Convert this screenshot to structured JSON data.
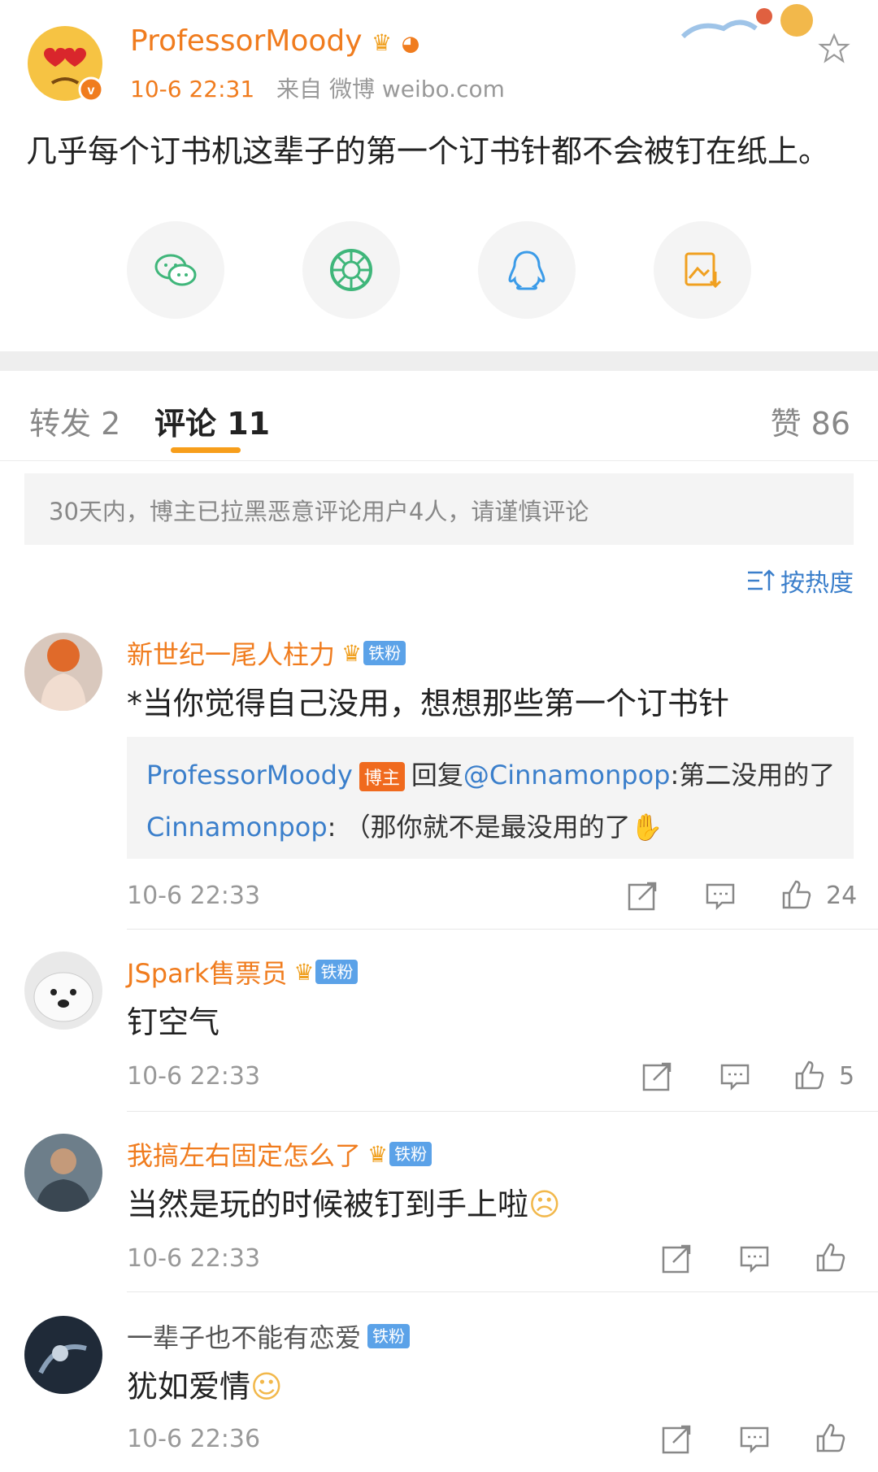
{
  "post": {
    "author": "ProfessorMoody",
    "time": "10-6 22:31",
    "source": "来自 微博 weibo.com",
    "text": "几乎每个订书机这辈子的第一个订书针都不会被钉在纸上。"
  },
  "share_icons": [
    "wechat-icon",
    "moments-icon",
    "qq-icon",
    "save-image-icon"
  ],
  "tabs": {
    "repost": "转发 2",
    "comments": "评论 11",
    "likes": "赞 86"
  },
  "notice": "30天内，博主已拉黑恶意评论用户4人，请谨慎评论",
  "sort_label": "按热度",
  "badges": {
    "fan": "铁粉",
    "host": "博主"
  },
  "comments": [
    {
      "name": "新世纪一尾人柱力",
      "text": "*当你觉得自己没用，想想那些第一个订书针",
      "replies": [
        {
          "user": "ProfessorMoody",
          "prefix": "回复",
          "mention": "@Cinnamonpop",
          "text": ":第二没用的了"
        },
        {
          "user": "Cinnamonpop",
          "text": ": （那你就不是最没用的了"
        }
      ],
      "time": "10-6 22:33",
      "likes": "24"
    },
    {
      "name": "JSpark售票员",
      "text": "钉空气",
      "time": "10-6 22:33",
      "likes": "5"
    },
    {
      "name": "我搞左右固定怎么了",
      "text": "当然是玩的时候被钉到手上啦",
      "time": "10-6 22:33",
      "likes": ""
    },
    {
      "name": "一辈子也不能有恋爱",
      "text": "犹如爱情",
      "time": "10-6 22:36",
      "likes": ""
    }
  ],
  "colors": {
    "accent_orange": "#f07c1e",
    "link_blue": "#3b7fcb",
    "tab_underline": "#f79e1b",
    "fan_badge": "#5ba2e8"
  }
}
